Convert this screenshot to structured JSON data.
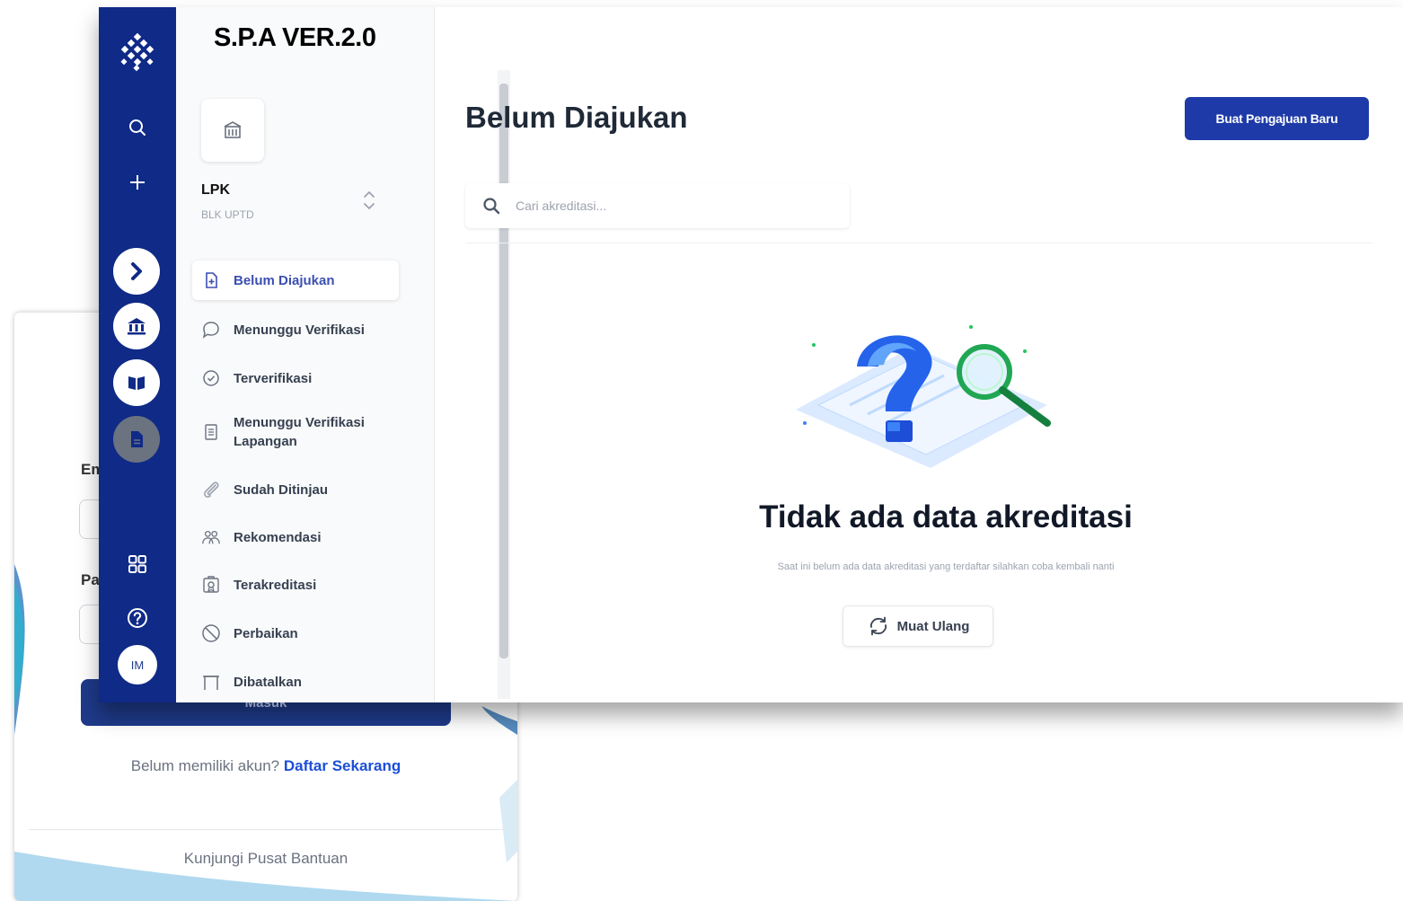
{
  "login": {
    "email_label": "Em",
    "password_label": "Pa",
    "submit_label": "Masuk",
    "register_prompt": "Belum memiliki akun?",
    "register_link": "Daftar Sekarang",
    "help_link": "Kunjungi Pusat Bantuan"
  },
  "rail": {
    "icons": [
      "logo-icon",
      "search-icon",
      "plus-icon",
      "arrow-right-icon",
      "bank-icon",
      "book-icon",
      "document-icon",
      "grid-icon",
      "help-icon"
    ],
    "avatar_initials": "IM"
  },
  "menu": {
    "app_title": "S.P.A VER.2.0",
    "org_name": "LPK",
    "org_sub": "BLK UPTD",
    "items": [
      {
        "label": "Belum Diajukan",
        "icon": "document-plus-icon",
        "active": true
      },
      {
        "label": "Menunggu Verifikasi",
        "icon": "chat-icon"
      },
      {
        "label": "Terverifikasi",
        "icon": "check-circle-icon"
      },
      {
        "label": "Menunggu Verifikasi Lapangan",
        "icon": "list-icon"
      },
      {
        "label": "Sudah Ditinjau",
        "icon": "paperclip-icon"
      },
      {
        "label": "Rekomendasi",
        "icon": "users-icon"
      },
      {
        "label": "Terakreditasi",
        "icon": "certificate-icon"
      },
      {
        "label": "Perbaikan",
        "icon": "ban-icon"
      },
      {
        "label": "Dibatalkan",
        "icon": "archive-icon"
      }
    ]
  },
  "main": {
    "page_title": "Belum Diajukan",
    "new_button": "Buat Pengajuan Baru",
    "search_placeholder": "Cari akreditasi...",
    "search_value": "",
    "empty_title": "Tidak ada data akreditasi",
    "empty_desc": "Saat ini belum ada data akreditasi yang terdaftar silahkan coba kembali nanti",
    "reload_button": "Muat Ulang"
  },
  "colors": {
    "rail_bg": "#0f2a87",
    "primary_button": "#1d3aa8",
    "active_menu_text": "#3b4fb0"
  }
}
